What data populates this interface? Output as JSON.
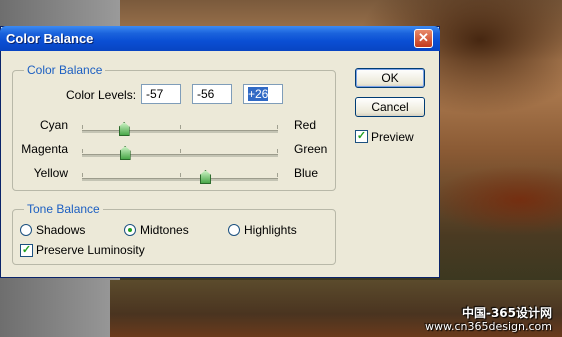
{
  "window": {
    "title": "Color Balance",
    "close_glyph": "✕"
  },
  "color_balance": {
    "group_title": "Color Balance",
    "levels_label": "Color Levels:",
    "levels": [
      "-57",
      "-56",
      "+26"
    ],
    "sliders": [
      {
        "left": "Cyan",
        "right": "Red",
        "value": -57
      },
      {
        "left": "Magenta",
        "right": "Green",
        "value": -56
      },
      {
        "left": "Yellow",
        "right": "Blue",
        "value": 26
      }
    ],
    "range": [
      -100,
      100
    ]
  },
  "tone_balance": {
    "group_title": "Tone Balance",
    "options": [
      "Shadows",
      "Midtones",
      "Highlights"
    ],
    "selected": "Midtones",
    "preserve_label": "Preserve Luminosity",
    "preserve_checked": true
  },
  "buttons": {
    "ok": "OK",
    "cancel": "Cancel"
  },
  "preview": {
    "label": "Preview",
    "checked": true
  },
  "watermark": {
    "line1": "中国-365设计网",
    "line2": "www.cn365design.com"
  },
  "colors": {
    "title_bar": "#0a4fd4",
    "group_title": "#1c5fc2",
    "dialog_bg": "#ece9d8"
  }
}
